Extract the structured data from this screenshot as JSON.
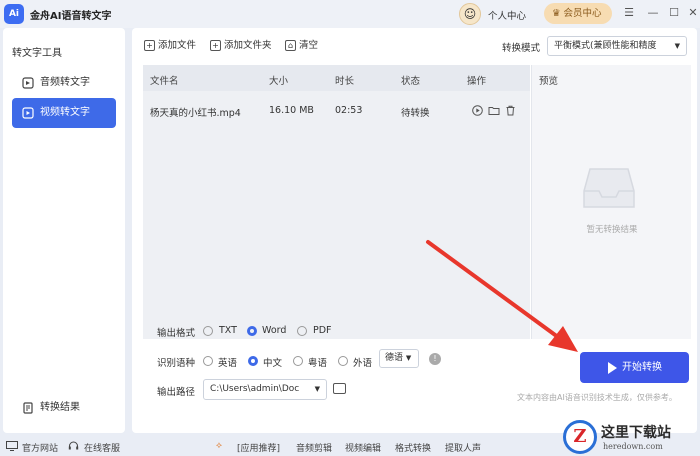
{
  "app": {
    "logo_text": "Ai",
    "title": "金舟AI语音转文字"
  },
  "titlebar": {
    "personal_center": "个人中心",
    "vip_center": "会员中心",
    "menu_glyph": "☰",
    "min_glyph": "—",
    "max_glyph": "☐",
    "close_glyph": "✕"
  },
  "sidebar": {
    "section_title": "转文字工具",
    "items": [
      {
        "label": "音频转文字",
        "icon": "audio-icon"
      },
      {
        "label": "视频转文字",
        "icon": "video-icon"
      }
    ],
    "result_label": "转换结果"
  },
  "toolbar": {
    "add_file": "添加文件",
    "add_folder": "添加文件夹",
    "clear": "清空",
    "mode_label": "转换模式",
    "mode_value": "平衡模式(兼顾性能和精度"
  },
  "table": {
    "headers": [
      "文件名",
      "大小",
      "时长",
      "状态",
      "操作"
    ],
    "rows": [
      {
        "name": "杨天真的小红书.mp4",
        "size": "16.10 MB",
        "duration": "02:53",
        "status": "待转换"
      }
    ]
  },
  "preview": {
    "title": "预览",
    "empty_text": "暂无转换结果"
  },
  "options": {
    "format_label": "输出格式",
    "formats": [
      "TXT",
      "Word",
      "PDF"
    ],
    "format_selected": "Word",
    "lang_label": "识别语种",
    "langs": [
      "英语",
      "中文",
      "粤语",
      "外语"
    ],
    "lang_selected": "中文",
    "dialect": "德语",
    "path_label": "输出路径",
    "path_value": "C:\\Users\\admin\\Doc"
  },
  "actions": {
    "start": "开始转换",
    "disclaimer": "文本内容由AI语音识别技术生成，仅供参考。"
  },
  "statusbar": {
    "website": "官方网站",
    "support": "在线客服",
    "recommend": "[应用推荐]",
    "links": [
      "音频剪辑",
      "视频编辑",
      "格式转换",
      "提取人声"
    ]
  },
  "watermark": {
    "mark": "Z",
    "title": "这里下载站",
    "site": "heredown.com"
  },
  "colors": {
    "accent": "#3e6ae8",
    "start_button": "#3e56e8",
    "arrow": "#e8372c",
    "vip_bg": "#f7dcb2"
  }
}
